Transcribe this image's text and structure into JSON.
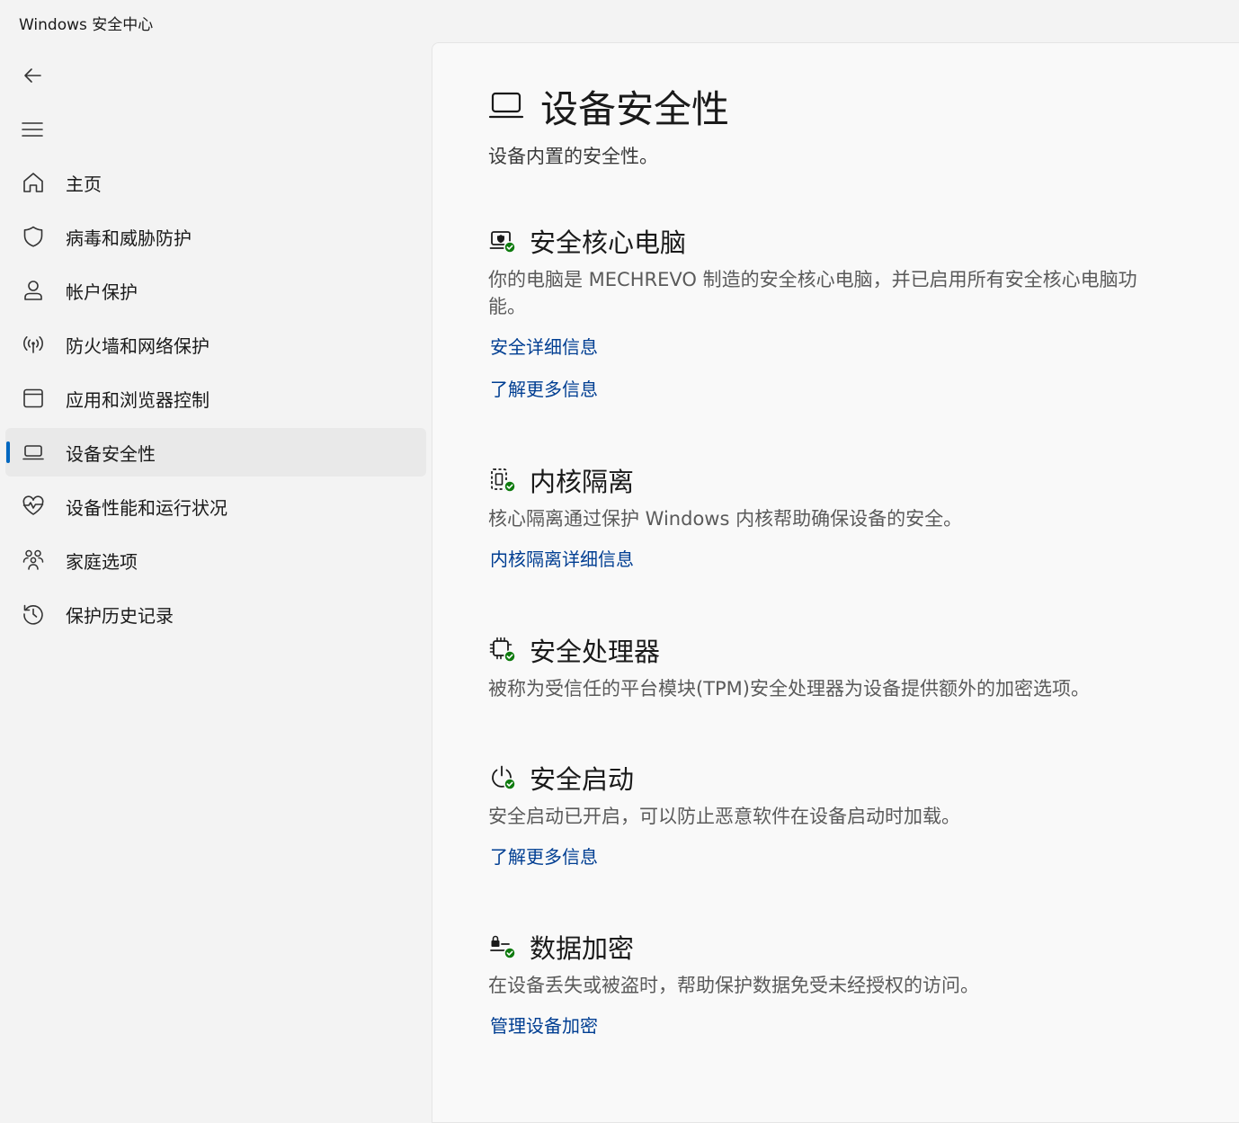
{
  "app": {
    "title": "Windows 安全中心"
  },
  "nav": {
    "back_icon": "back-arrow-icon",
    "menu_icon": "hamburger-menu-icon"
  },
  "sidebar": {
    "items": [
      {
        "label": "主页",
        "icon": "home-icon"
      },
      {
        "label": "病毒和威胁防护",
        "icon": "shield-icon"
      },
      {
        "label": "帐户保护",
        "icon": "person-icon"
      },
      {
        "label": "防火墙和网络保护",
        "icon": "wireless-signal-icon"
      },
      {
        "label": "应用和浏览器控制",
        "icon": "app-window-icon"
      },
      {
        "label": "设备安全性",
        "icon": "laptop-icon",
        "active": true
      },
      {
        "label": "设备性能和运行状况",
        "icon": "heart-pulse-icon"
      },
      {
        "label": "家庭选项",
        "icon": "family-icon"
      },
      {
        "label": "保护历史记录",
        "icon": "history-icon"
      }
    ]
  },
  "main": {
    "title": "设备安全性",
    "title_icon": "laptop-icon",
    "subtitle": "设备内置的安全性。",
    "sections": [
      {
        "title": "安全核心电脑",
        "icon": "secured-core-pc-check-icon",
        "description": "你的电脑是 MECHREVO 制造的安全核心电脑，并已启用所有安全核心电脑功能。",
        "links": [
          "安全详细信息",
          "了解更多信息"
        ]
      },
      {
        "title": "内核隔离",
        "icon": "core-isolation-check-icon",
        "description": "核心隔离通过保护 Windows 内核帮助确保设备的安全。",
        "links": [
          "内核隔离详细信息"
        ]
      },
      {
        "title": "安全处理器",
        "icon": "security-processor-check-icon",
        "description": "被称为受信任的平台模块(TPM)安全处理器为设备提供额外的加密选项。",
        "links": []
      },
      {
        "title": "安全启动",
        "icon": "secure-boot-check-icon",
        "description": "安全启动已开启，可以防止恶意软件在设备启动时加载。",
        "links": [
          "了解更多信息"
        ]
      },
      {
        "title": "数据加密",
        "icon": "data-encryption-check-icon",
        "description": "在设备丢失或被盗时，帮助保护数据免受未经授权的访问。",
        "links": [
          "管理设备加密"
        ]
      }
    ]
  },
  "colors": {
    "accent": "#0067c0",
    "link": "#003e92",
    "status_ok": "#0f7b0f"
  }
}
